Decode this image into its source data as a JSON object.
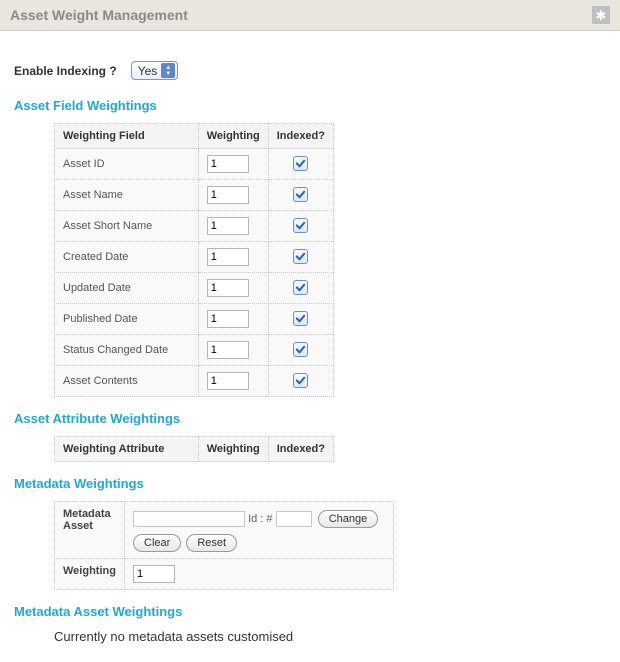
{
  "title": "Asset Weight Management",
  "enable_indexing": {
    "label": "Enable Indexing ?",
    "value": "Yes"
  },
  "sections": {
    "field": {
      "title": "Asset Field Weightings",
      "headers": {
        "field": "Weighting Field",
        "weight": "Weighting",
        "indexed": "Indexed?"
      },
      "rows": [
        {
          "field": "Asset ID",
          "weight": "1",
          "indexed": true
        },
        {
          "field": "Asset Name",
          "weight": "1",
          "indexed": true
        },
        {
          "field": "Asset Short Name",
          "weight": "1",
          "indexed": true
        },
        {
          "field": "Created Date",
          "weight": "1",
          "indexed": true
        },
        {
          "field": "Updated Date",
          "weight": "1",
          "indexed": true
        },
        {
          "field": "Published Date",
          "weight": "1",
          "indexed": true
        },
        {
          "field": "Status Changed Date",
          "weight": "1",
          "indexed": true
        },
        {
          "field": "Asset Contents",
          "weight": "1",
          "indexed": true
        }
      ]
    },
    "attribute": {
      "title": "Asset Attribute Weightings",
      "headers": {
        "field": "Weighting Attribute",
        "weight": "Weighting",
        "indexed": "Indexed?"
      }
    },
    "metadata": {
      "title": "Metadata Weightings",
      "labels": {
        "asset": "Metadata Asset",
        "weight": "Weighting",
        "id_text": "Id : #"
      },
      "id_name": "",
      "id_num": "",
      "buttons": {
        "change": "Change",
        "clear": "Clear",
        "reset": "Reset"
      },
      "weight": "1"
    },
    "asset_weightings": {
      "title": "Metadata Asset Weightings",
      "message": "Currently no metadata assets customised"
    }
  }
}
